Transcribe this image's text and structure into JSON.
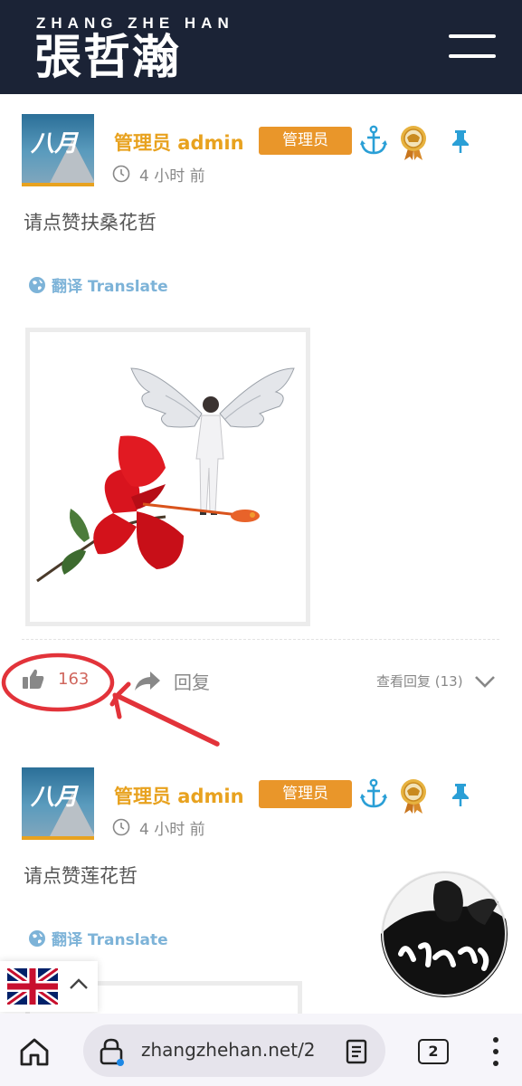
{
  "site": {
    "logo_sub": "ZHANG ZHE HAN",
    "logo_main": "張哲瀚"
  },
  "posts": [
    {
      "avatar_text": "八月",
      "username": "管理员 admin",
      "role_badge": "管理员",
      "time": "4 小时 前",
      "text": "请点赞扶桑花哲",
      "translate_label": "翻译 Translate",
      "like_count": "163",
      "reply_label": "回复",
      "view_replies_label": "查看回复 (13)"
    },
    {
      "avatar_text": "八月",
      "username": "管理员 admin",
      "role_badge": "管理员",
      "time": "4 小时 前",
      "text": "请点赞莲花哲",
      "translate_label": "翻译 Translate"
    }
  ],
  "colors": {
    "header_bg": "#1b2336",
    "accent_orange": "#e8a21f",
    "badge_orange": "#e9962a",
    "annotation_red": "#e2333a",
    "translate_blue": "#7db3d8",
    "anchor_blue": "#2a9fd6"
  },
  "icons": {
    "menu": "hamburger-icon",
    "clock": "clock-icon",
    "globe": "globe-icon",
    "like": "thumbs-up-icon",
    "reply": "share-arrow-icon",
    "expand": "chevron-down-icon",
    "role": "anchor-icon",
    "medal": "medal-icon",
    "pin": "pin-icon"
  },
  "language_switch": {
    "flag": "uk-flag-icon"
  },
  "browser": {
    "url": "zhangzhehan.net/2",
    "tab_count": "2"
  }
}
